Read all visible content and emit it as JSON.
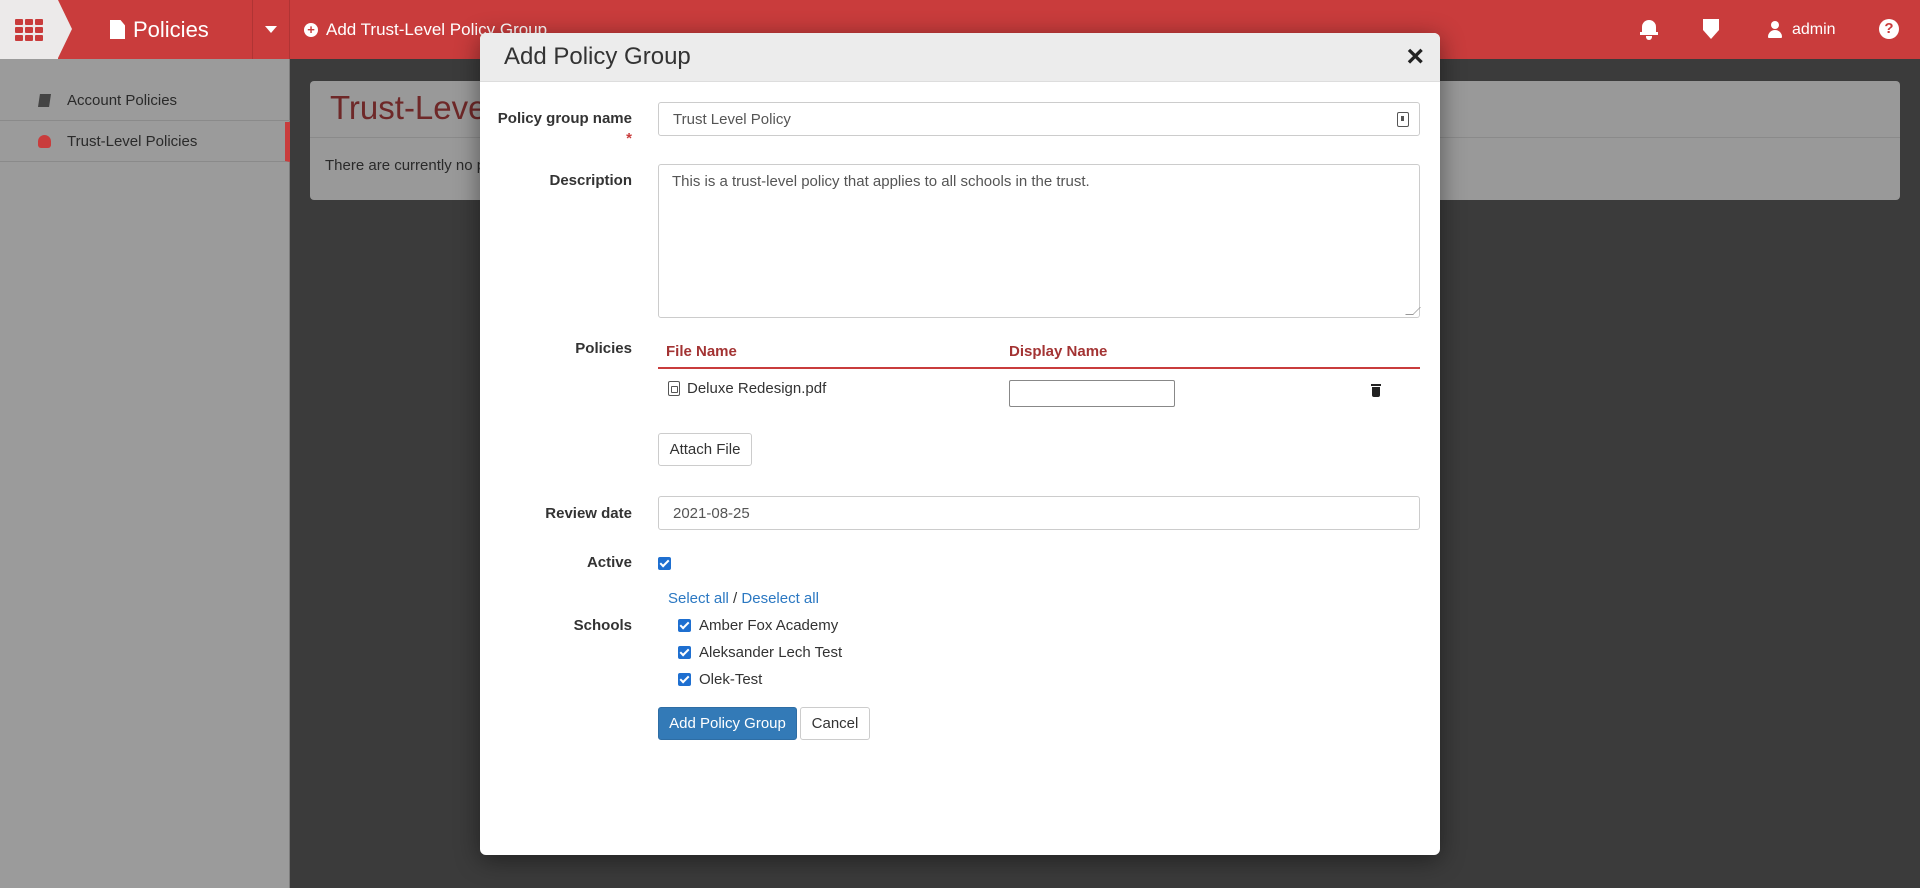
{
  "topbar": {
    "module_title": "Policies",
    "action_label": "Add Trust-Level Policy Group",
    "user_name": "admin",
    "accent_color": "#c93c3c",
    "icons": [
      "apps-grid-icon",
      "document-icon",
      "caret-down-icon",
      "plus-circle-icon",
      "bell-icon",
      "shield-icon",
      "user-icon",
      "help-icon"
    ]
  },
  "sidebar": {
    "items": [
      {
        "label": "Account Policies",
        "icon": "book-icon",
        "active": false
      },
      {
        "label": "Trust-Level Policies",
        "icon": "users-icon",
        "active": true
      }
    ]
  },
  "page": {
    "title": "Trust-Level",
    "empty_text": "There are currently no p"
  },
  "modal": {
    "title": "Add Policy Group",
    "close_glyph": "×",
    "group_name_label": "Policy group name",
    "required_mark": "*",
    "group_name_value": "Trust Level Policy",
    "description_label": "Description",
    "description_value": "This is a trust-level policy that applies to all schools in the trust.",
    "policies_label": "Policies",
    "policies_table": {
      "headers": [
        "File Name",
        "Display Name"
      ],
      "rows": [
        {
          "file_name": "Deluxe Redesign.pdf",
          "display_name": ""
        }
      ]
    },
    "attach_file_label": "Attach File",
    "review_date_label": "Review date",
    "review_date_value": "2021-08-25",
    "active_label": "Active",
    "active_checked": true,
    "select_all_label": "Select all",
    "separator": "/",
    "deselect_all_label": "Deselect all",
    "schools_label": "Schools",
    "schools": [
      {
        "name": "Amber Fox Academy",
        "checked": true
      },
      {
        "name": "Aleksander Lech Test",
        "checked": true
      },
      {
        "name": "Olek-Test",
        "checked": true
      }
    ],
    "submit_label": "Add Policy Group",
    "cancel_label": "Cancel",
    "primary_color": "#337ab7"
  }
}
